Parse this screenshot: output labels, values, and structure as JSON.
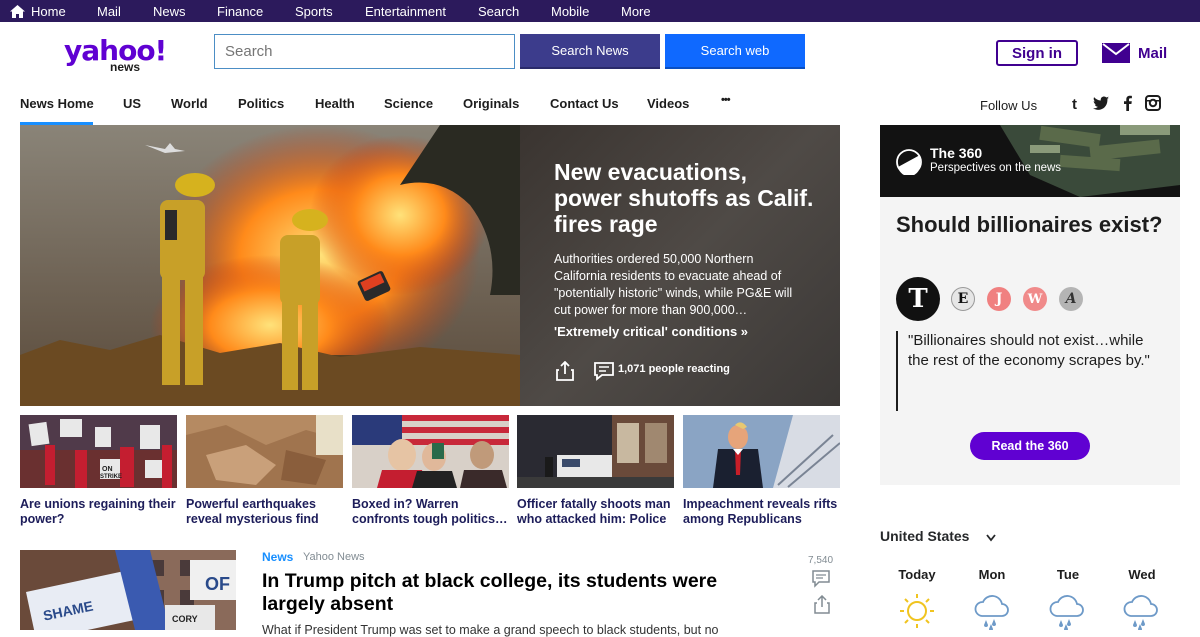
{
  "topbar": {
    "items": [
      "Home",
      "Mail",
      "News",
      "Finance",
      "Sports",
      "Entertainment",
      "Search",
      "Mobile",
      "More"
    ]
  },
  "header": {
    "logo_main": "yahoo!",
    "logo_sub": "news",
    "search_placeholder": "Search",
    "search_news_label": "Search News",
    "search_web_label": "Search web",
    "signin_label": "Sign in",
    "mail_label": "Mail"
  },
  "nav": {
    "items": [
      "News Home",
      "US",
      "World",
      "Politics",
      "Health",
      "Science",
      "Originals",
      "Contact Us",
      "Videos",
      "•••"
    ],
    "follow_label": "Follow Us",
    "active_index": 0
  },
  "hero": {
    "title": "New evacuations, power shutoffs as Calif. fires rage",
    "description": "Authorities ordered 50,000 Northern California residents to evacuate ahead of \"potentially historic\" winds, while PG&E will cut power for more than 900,000…",
    "link": "'Extremely critical' conditions »",
    "reactions": "1,071 people reacting"
  },
  "thumbnails": [
    {
      "caption": "Are unions regaining their power?"
    },
    {
      "caption": "Powerful earthquakes reveal mysterious find"
    },
    {
      "caption": "Boxed in? Warren confronts tough politics…"
    },
    {
      "caption": "Officer fatally shoots man who attacked him: Police"
    },
    {
      "caption": "Impeachment reveals rifts among Republicans"
    }
  ],
  "story": {
    "category": "News",
    "source": "Yahoo News",
    "title": "In Trump pitch at black college, its students were largely absent",
    "description": "What if President Trump was set to make a grand speech to black students, but no",
    "comment_count": "7,540"
  },
  "panel": {
    "brand": "The 360",
    "subtitle": "Perspectives on the news",
    "title": "Should billionaires exist?",
    "publishers": [
      "T",
      "E",
      "J",
      "W",
      "A"
    ],
    "quote": "\"Billionaires should not exist…while the rest of the economy scrapes by.\"",
    "button_label": "Read the 360"
  },
  "weather": {
    "country": "United States",
    "days": [
      "Today",
      "Mon",
      "Tue",
      "Wed"
    ]
  },
  "colors": {
    "topbar": "#2c1a5c",
    "brand": "#6001d2",
    "link_blue": "#188fff",
    "search_web": "#0f69ff"
  }
}
